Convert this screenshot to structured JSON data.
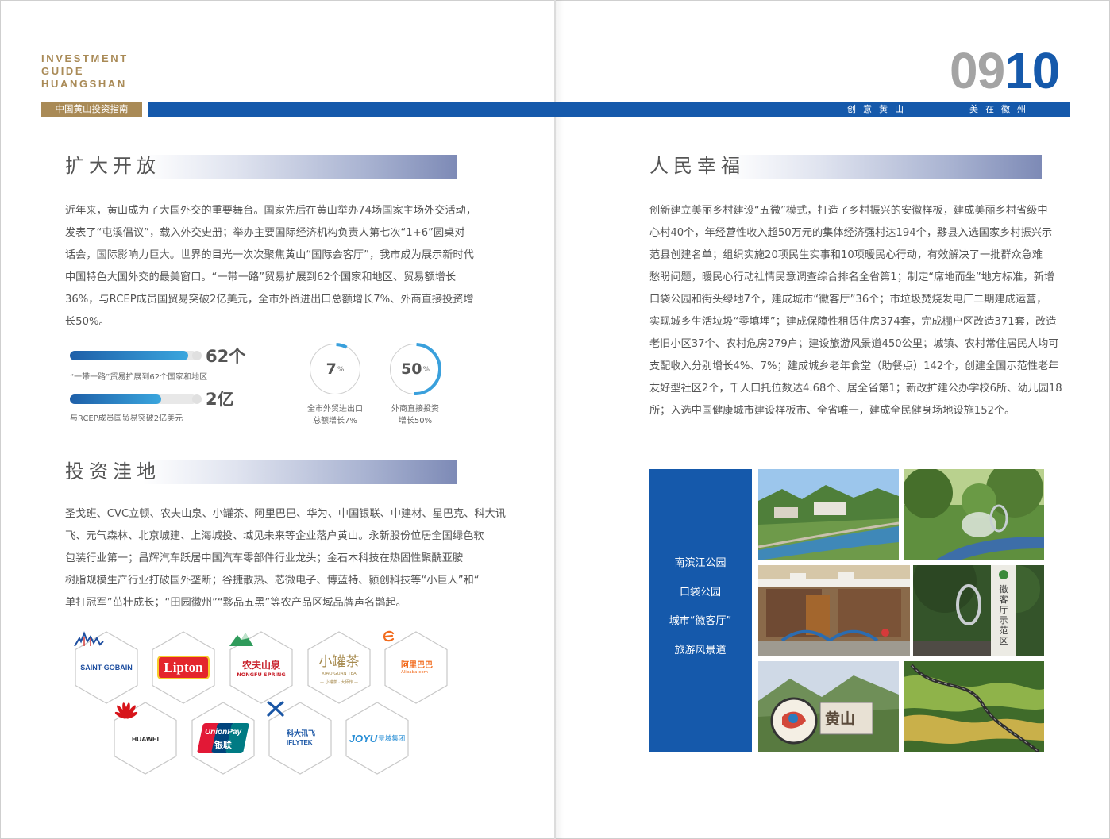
{
  "header": {
    "brand_lines": [
      "INVESTMENT",
      "GUIDE",
      "HUANGSHAN"
    ],
    "guide_tag": "中国黄山投资指南",
    "slogan_left": "创意黄山",
    "slogan_right": "美在徽州",
    "page_num_a": "09",
    "page_num_b": "10"
  },
  "left": {
    "open": {
      "title": "扩大开放",
      "lines": [
        "近年来，黄山成为了大国外交的重要舞台。国家先后在黄山举办74场国家主场外交活动，",
        "发表了“屯溪倡议”，载入外交史册；举办主要国际经济机构负责人第七次“1+6”圆桌对",
        "话会，国际影响力巨大。世界的目光一次次聚焦黄山“国际会客厅”，我市成为展示新时代",
        "中国特色大国外交的最美窗口。“一带一路”贸易扩展到62个国家和地区、贸易额增长",
        "36%，与RCEP成员国贸易突破2亿美元，全市外贸进出口总额增长7%、外商直接投资增",
        "长50%。"
      ],
      "stats": [
        {
          "value": "62个",
          "caption": "“一带一路”贸易扩展到62个国家和地区",
          "fill": 0.93
        },
        {
          "value": "2亿",
          "caption": "与RCEP成员国贸易突破2亿美元",
          "fill": 0.72
        }
      ],
      "rings": [
        {
          "num": "7",
          "unit": "%",
          "percent": 7,
          "caption_1": "全市外贸进出口",
          "caption_2": "总额增长7%"
        },
        {
          "num": "50",
          "unit": "%",
          "percent": 50,
          "caption_1": "外商直接投资",
          "caption_2": "增长50%"
        }
      ]
    },
    "invest": {
      "title": "投资洼地",
      "lines": [
        "圣戈班、CVC立顿、农夫山泉、小罐茶、阿里巴巴、华为、中国银联、中建材、星巴克、科大讯",
        "飞、元气森林、北京城建、上海城投、域见未来等企业落户黄山。永新股份位居全国绿色软",
        "包装行业第一；昌辉汽车跃居中国汽车零部件行业龙头；金石木科技在热固性聚酰亚胺",
        "树脂规模生产行业打破国外垄断；谷捷散热、芯微电子、博蓝特、颍创科技等“小巨人”和“",
        "单打冠军”茁壮成长；“田园徽州”“黟品五黑”等农产品区域品牌声名鹊起。"
      ]
    },
    "logos": {
      "saint_gobain": "SAINT-GOBAIN",
      "lipton": "Lipton",
      "nongfu_cn": "农夫山泉",
      "nongfu_en": "NONGFU SPRING",
      "xiaoguan_cn": "小罐茶",
      "xiaoguan_en": "XIAO GUAN TEA",
      "xiaoguan_sub": "— 小罐茶 · 大师作 —",
      "alibaba_cn": "阿里巴巴",
      "alibaba_en": "Alibaba.com",
      "huawei": "HUAWEI",
      "unionpay_en": "UnionPay",
      "unionpay_cn": "银联",
      "iflytek_cn": "科大讯飞",
      "iflytek_en": "iFLYTEK",
      "joyu_en": "JOYU",
      "joyu_cn": "景域集团"
    }
  },
  "right": {
    "happy": {
      "title": "人民幸福",
      "lines": [
        "创新建立美丽乡村建设“五微”模式，打造了乡村振兴的安徽样板，建成美丽乡村省级中",
        "心村40个，年经营性收入超50万元的集体经济强村达194个，黟县入选国家乡村振兴示",
        "范县创建名单；组织实施20项民生实事和10项暖民心行动，有效解决了一批群众急难",
        "愁盼问题，暖民心行动社情民意调查综合排名全省第1；制定“席地而坐”地方标准，新增",
        "口袋公园和街头绿地7个，建成城市“徽客厅”36个；市垃圾焚烧发电厂二期建成运营，",
        "实现城乡生活垃圾“零填埋”；建成保障性租赁住房374套，完成棚户区改造371套，改造",
        "老旧小区37个、农村危房279户；建设旅游风景道450公里；城镇、农村常住居民人均可",
        "支配收入分别增长4%、7%；建成城乡老年食堂（助餐点）142个，创建全国示范性老年",
        "友好型社区2个，千人口托位数达4.68个、居全省第1；新改扩建公办学校6所、幼儿园18",
        "所；入选中国健康城市建设样板市、全省唯一，建成全民健身场地设施152个。"
      ]
    },
    "panel": [
      "南滨江公园",
      "口袋公园",
      "城市“徽客厅”",
      "旅游风景道"
    ],
    "photo_sign_text": "徽客厅示范区",
    "photo_sign2_text": "黄山"
  },
  "colors": {
    "brand_blue": "#1559ab",
    "gold": "#a98a56",
    "gray_num": "#a4a4a4"
  }
}
